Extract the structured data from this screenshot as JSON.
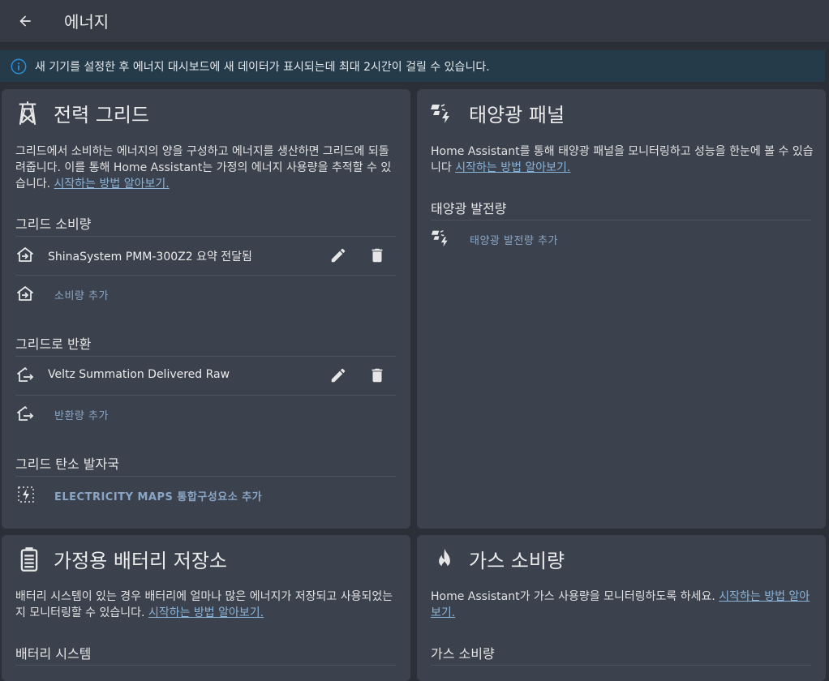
{
  "header": {
    "title": "에너지"
  },
  "alert": {
    "text": "새 기기를 설정한 후 에너지 대시보드에 새 데이터가 표시되는데 최대 2시간이 걸릴 수 있습니다."
  },
  "grid": {
    "title": "전력 그리드",
    "desc": "그리드에서 소비하는 에너지의 양을 구성하고 에너지를 생산하면 그리드에 되돌려줍니다. 이를 통해 Home Assistant는 가정의 에너지 사용량을 추적할 수 있습니다.",
    "link": "시작하는 방법 알아보기.",
    "consumption_label": "그리드 소비량",
    "consumption_item": "ShinaSystem PMM-300Z2 요약 전달됨",
    "add_consumption": "소비량 추가",
    "return_label": "그리드로 반환",
    "return_item": "Veltz Summation Delivered Raw",
    "add_return": "반환량 추가",
    "carbon_label": "그리드 탄소 발자국",
    "add_carbon": "ELECTRICITY MAPS 통합구성요소 추가"
  },
  "solar": {
    "title": "태양광 패널",
    "desc": "Home Assistant를 통해 태양광 패널을 모니터링하고 성능을 한눈에 볼 수 있습니다",
    "link": "시작하는 방법 알아보기.",
    "production_label": "태양광 발전량",
    "add_production": "태양광 발전량 추가"
  },
  "battery": {
    "title": "가정용 배터리 저장소",
    "desc": "배터리 시스템이 있는 경우 배터리에 얼마나 많은 에너지가 저장되고 사용되었는지 모니터링할 수 있습니다.",
    "link": "시작하는 방법 알아보기.",
    "systems_label": "배터리 시스템"
  },
  "gas": {
    "title": "가스 소비량",
    "desc": "Home Assistant가 가스 사용량을 모니터링하도록 하세요.",
    "link": "시작하는 방법 알아보기.",
    "consumption_label": "가스 소비량"
  },
  "colors": {
    "background": "#2b2f37",
    "card": "#3b414d",
    "link": "#8ab4d8",
    "info": "#2a8fd8"
  }
}
